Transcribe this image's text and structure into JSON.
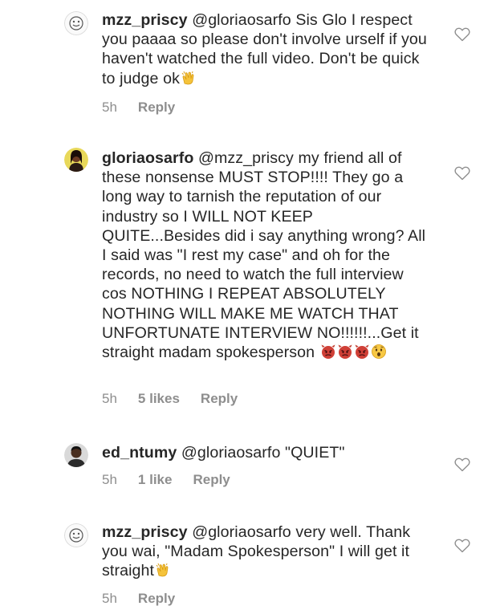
{
  "comments": [
    {
      "username": "mzz_priscy",
      "text": " @gloriaosarfo Sis Glo I respect you paaaa so please don't involve urself if you haven't watched the full video. Don't be quick to judge ok",
      "emoji_after": [
        "clapping-hands"
      ],
      "time": "5h",
      "likes": "",
      "reply": "Reply"
    },
    {
      "username": "gloriaosarfo",
      "text": " @mzz_priscy my friend all of these nonsense MUST STOP!!!! They go a long way to tarnish the reputation of our industry so I WILL NOT KEEP QUITE...Besides did i say anything wrong? All I said was \"I rest my case\" and oh for the records, no need to watch the full interview cos NOTHING I REPEAT ABSOLUTELY NOTHING WILL MAKE ME WATCH THAT UNFORTUNATE INTERVIEW NO!!!!!!...Get it straight madam spokesperson ",
      "emoji_after": [
        "angry-devil",
        "angry-devil",
        "angry-devil",
        "astonished-face"
      ],
      "time": "5h",
      "likes": "5 likes",
      "reply": "Reply"
    },
    {
      "username": "ed_ntumy",
      "text": " @gloriaosarfo \"QUIET\"",
      "emoji_after": [],
      "time": "5h",
      "likes": "1 like",
      "reply": "Reply"
    },
    {
      "username": "mzz_priscy",
      "text": " @gloriaosarfo very well. Thank you wai, \"Madam Spokesperson\" I will get it straight",
      "emoji_after": [
        "clapping-hands"
      ],
      "time": "5h",
      "likes": "",
      "reply": "Reply"
    }
  ],
  "colors": {
    "text": "#262626",
    "meta": "#8e8e8e",
    "heart_stroke": "#8e8e8e"
  },
  "icons": {
    "like": "heart-outline-icon",
    "clap": "clapping-hands-emoji",
    "devil": "angry-devil-emoji",
    "astonished": "astonished-face-emoji"
  }
}
